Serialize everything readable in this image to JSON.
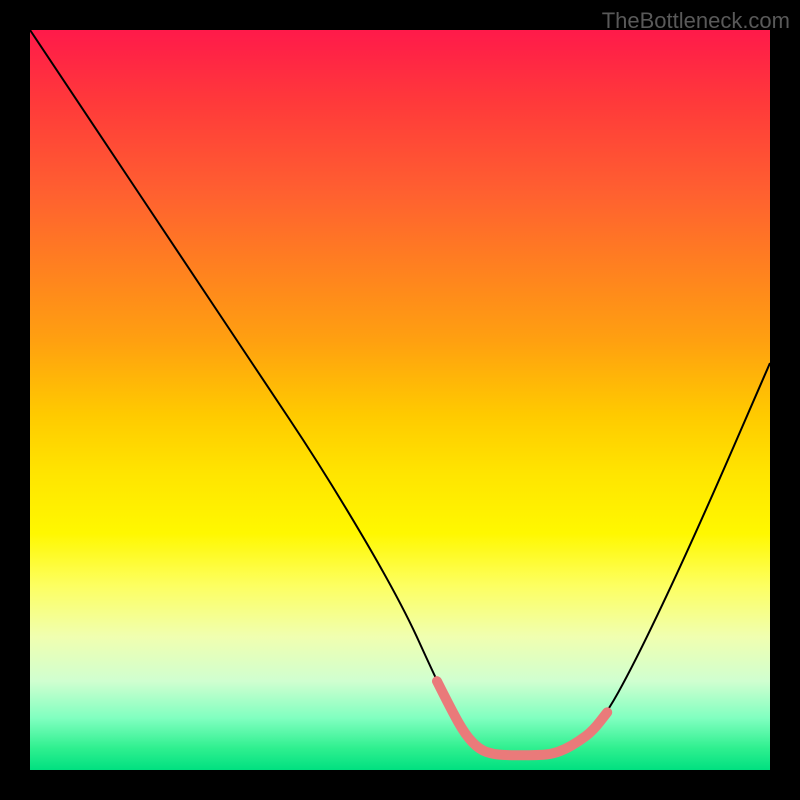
{
  "watermark": "TheBottleneck.com",
  "chart_data": {
    "type": "line",
    "title": "",
    "xlabel": "",
    "ylabel": "",
    "ylim": [
      0,
      100
    ],
    "xlim": [
      0,
      100
    ],
    "series": [
      {
        "name": "bottleneck-curve",
        "x": [
          0,
          10,
          20,
          30,
          40,
          50,
          55,
          58,
          60,
          63,
          67,
          70,
          73,
          77,
          82,
          90,
          100
        ],
        "values": [
          100,
          85,
          70,
          55,
          40,
          23,
          12,
          6,
          3,
          2,
          2,
          2,
          3,
          6,
          15,
          32,
          55
        ]
      }
    ],
    "annotations": [
      {
        "type": "highlight-segment",
        "x_start": 55,
        "x_end": 78,
        "color": "#ea7a7a",
        "thickness": 10
      }
    ],
    "gradient_stops": [
      {
        "pos": 0.0,
        "color": "#ff1a4a"
      },
      {
        "pos": 0.1,
        "color": "#ff3a3a"
      },
      {
        "pos": 0.22,
        "color": "#ff6030"
      },
      {
        "pos": 0.32,
        "color": "#ff8020"
      },
      {
        "pos": 0.42,
        "color": "#ffa010"
      },
      {
        "pos": 0.52,
        "color": "#ffca00"
      },
      {
        "pos": 0.6,
        "color": "#ffe500"
      },
      {
        "pos": 0.68,
        "color": "#fff800"
      },
      {
        "pos": 0.75,
        "color": "#fdff60"
      },
      {
        "pos": 0.82,
        "color": "#f0ffb0"
      },
      {
        "pos": 0.88,
        "color": "#d0ffd0"
      },
      {
        "pos": 0.93,
        "color": "#80ffc0"
      },
      {
        "pos": 0.97,
        "color": "#30f090"
      },
      {
        "pos": 1.0,
        "color": "#00e080"
      }
    ]
  }
}
